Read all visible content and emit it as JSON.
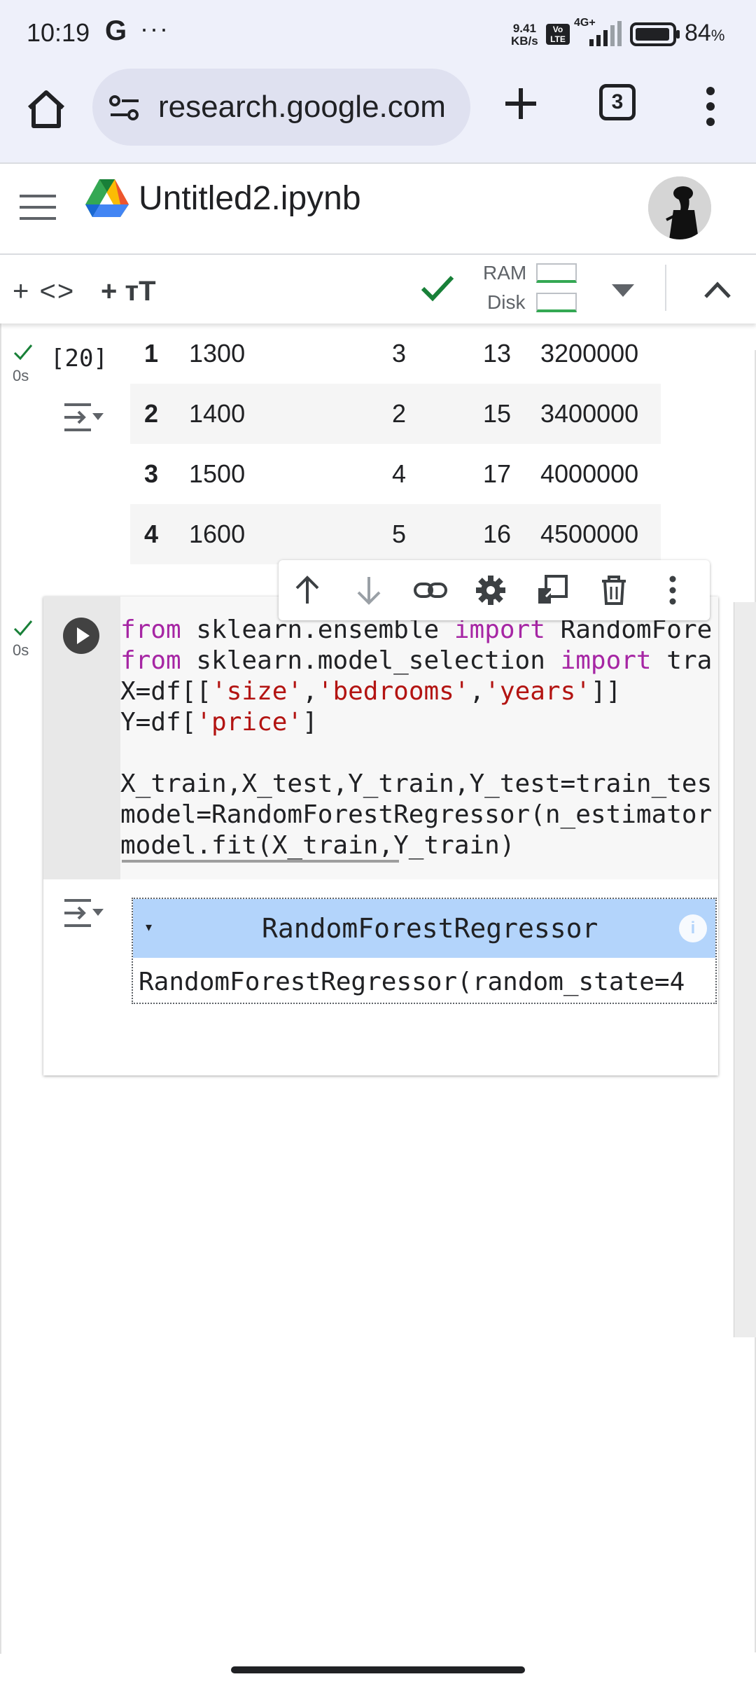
{
  "status_bar": {
    "time": "10:19",
    "g_label": "G",
    "more_dots": "···",
    "net_speed_value": "9.41",
    "net_speed_unit": "KB/s",
    "volte": "Vo LTE",
    "network_type": "4G+",
    "battery_pct": "84",
    "battery_unit": "%"
  },
  "browser": {
    "url": "research.google.com",
    "tab_count": "3"
  },
  "notebook": {
    "title": "Untitled2.ipynb"
  },
  "toolbar": {
    "add_code": "+ <>",
    "add_text": "+ тT",
    "ram_label": "RAM",
    "disk_label": "Disk"
  },
  "cell_20": {
    "execution_count": "[20]",
    "time": "0s",
    "rows": [
      {
        "index": "1",
        "size": "1300",
        "bedrooms": "3",
        "years": "13",
        "price": "3200000"
      },
      {
        "index": "2",
        "size": "1400",
        "bedrooms": "2",
        "years": "15",
        "price": "3400000"
      },
      {
        "index": "3",
        "size": "1500",
        "bedrooms": "4",
        "years": "17",
        "price": "4000000"
      },
      {
        "index": "4",
        "size": "1600",
        "bedrooms": "5",
        "years": "16",
        "price": "4500000"
      }
    ]
  },
  "cell_21": {
    "time": "0s",
    "code": {
      "l1_a": "from",
      "l1_b": " sklearn.ensemble ",
      "l1_c": "import",
      "l1_d": " RandomFore",
      "l2_a": "from",
      "l2_b": " sklearn.model_selection ",
      "l2_c": "import",
      "l2_d": " tra",
      "l3_a": "X=df[[",
      "l3_b": "'size'",
      "l3_c": ",",
      "l3_d": "'bedrooms'",
      "l3_e": ",",
      "l3_f": "'years'",
      "l3_g": "]]",
      "l4_a": "Y=df[",
      "l4_b": "'price'",
      "l4_c": "]",
      "l5": "X_train,X_test,Y_train,Y_test=train_tes",
      "l6": "model=RandomForestRegressor(n_estimator",
      "l7": "model.fit(X_train,Y_train)"
    },
    "output": {
      "toggle": "▾",
      "estimator_name": "RandomForestRegressor",
      "info": "i",
      "repr": "RandomForestRegressor(random_state=4"
    }
  },
  "colors": {
    "accent_green": "#34a853",
    "keyword": "#a626a4",
    "string": "#b31412",
    "estimator_header": "#b3d4fb"
  }
}
